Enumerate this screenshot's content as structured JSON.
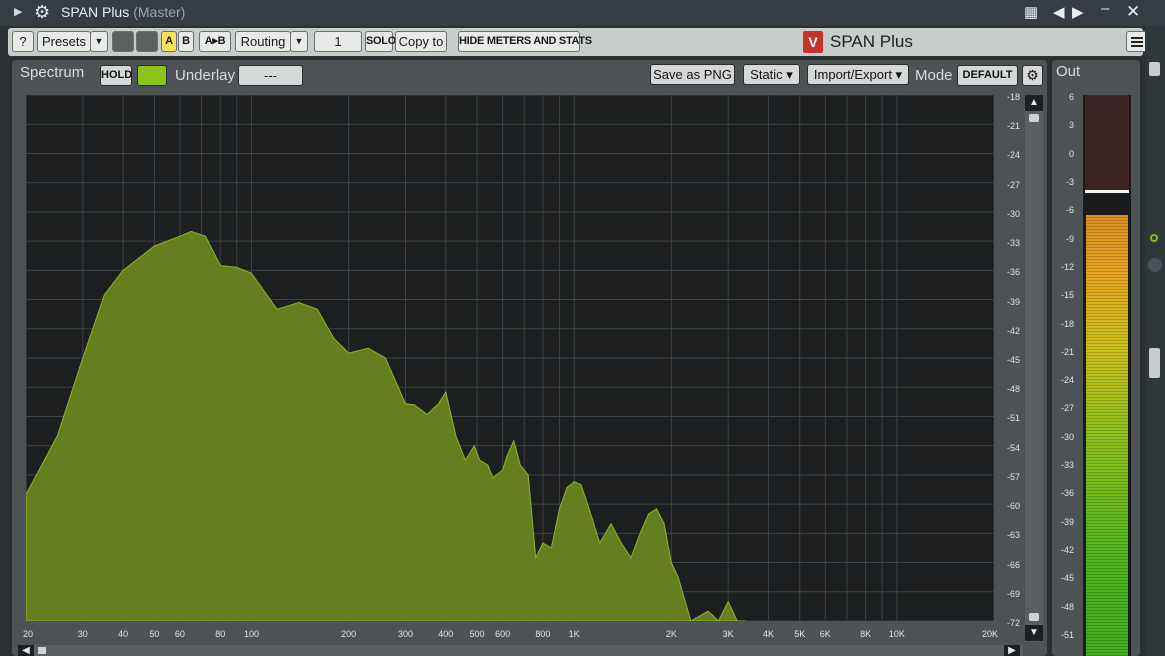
{
  "window": {
    "title": "SPAN Plus",
    "subtitle": "(Master)"
  },
  "toolbar": {
    "help_label": "?",
    "presets_label": "Presets",
    "a_label": "A",
    "b_label": "B",
    "ab_label": "A▸B",
    "routing_label": "Routing",
    "routing_value": "1",
    "solo_label": "SOLO",
    "copy_label": "Copy to",
    "hide_label": "HIDE METERS AND STATS",
    "logo_mark": "V",
    "logo_text": "SPAN Plus"
  },
  "spectrum_bar": {
    "spectrum_label": "Spectrum",
    "hold_label": "HOLD",
    "underlay_label": "Underlay",
    "underlay_value": "---",
    "save_png_label": "Save as PNG",
    "static_label": "Static ▾",
    "import_export_label": "Import/Export ▾",
    "mode_label": "Mode",
    "mode_value": "DEFAULT"
  },
  "out_label": "Out",
  "spectrum": {
    "db_ticks": [
      "-18",
      "-21",
      "-24",
      "-27",
      "-30",
      "-33",
      "-36",
      "-39",
      "-42",
      "-45",
      "-48",
      "-51",
      "-54",
      "-57",
      "-60",
      "-63",
      "-66",
      "-69",
      "-72"
    ],
    "freq_ticks": [
      {
        "label": "20",
        "hz": 20
      },
      {
        "label": "30",
        "hz": 30
      },
      {
        "label": "40",
        "hz": 40
      },
      {
        "label": "50",
        "hz": 50
      },
      {
        "label": "60",
        "hz": 60
      },
      {
        "label": "80",
        "hz": 80
      },
      {
        "label": "100",
        "hz": 100
      },
      {
        "label": "200",
        "hz": 200
      },
      {
        "label": "300",
        "hz": 300
      },
      {
        "label": "400",
        "hz": 400
      },
      {
        "label": "500",
        "hz": 500
      },
      {
        "label": "600",
        "hz": 600
      },
      {
        "label": "800",
        "hz": 800
      },
      {
        "label": "1K",
        "hz": 1000
      },
      {
        "label": "2K",
        "hz": 2000
      },
      {
        "label": "3K",
        "hz": 3000
      },
      {
        "label": "4K",
        "hz": 4000
      },
      {
        "label": "5K",
        "hz": 5000
      },
      {
        "label": "6K",
        "hz": 6000
      },
      {
        "label": "8K",
        "hz": 8000
      },
      {
        "label": "10K",
        "hz": 10000
      },
      {
        "label": "20K",
        "hz": 20000
      }
    ],
    "db_range": [
      -72,
      -18
    ],
    "freq_range_hz": [
      20,
      20000
    ],
    "fill_color": "#6b8720",
    "curve": [
      [
        20,
        -59
      ],
      [
        25,
        -53
      ],
      [
        30,
        -45
      ],
      [
        35,
        -38.5
      ],
      [
        40,
        -36
      ],
      [
        50,
        -33.5
      ],
      [
        60,
        -32.5
      ],
      [
        65,
        -32
      ],
      [
        72,
        -32.5
      ],
      [
        80,
        -35.5
      ],
      [
        90,
        -35.7
      ],
      [
        100,
        -36.3
      ],
      [
        120,
        -40
      ],
      [
        140,
        -39.3
      ],
      [
        160,
        -40
      ],
      [
        180,
        -43
      ],
      [
        200,
        -44.5
      ],
      [
        230,
        -44
      ],
      [
        260,
        -45
      ],
      [
        300,
        -49.7
      ],
      [
        320,
        -49.8
      ],
      [
        350,
        -50.8
      ],
      [
        380,
        -49.7
      ],
      [
        400,
        -48.5
      ],
      [
        430,
        -53
      ],
      [
        460,
        -55.5
      ],
      [
        490,
        -54
      ],
      [
        510,
        -55.5
      ],
      [
        540,
        -56
      ],
      [
        560,
        -57.3
      ],
      [
        600,
        -56.5
      ],
      [
        620,
        -55
      ],
      [
        650,
        -53.5
      ],
      [
        680,
        -56
      ],
      [
        720,
        -57
      ],
      [
        760,
        -65.5
      ],
      [
        800,
        -64
      ],
      [
        850,
        -64.5
      ],
      [
        900,
        -60.5
      ],
      [
        950,
        -58.3
      ],
      [
        1000,
        -57.7
      ],
      [
        1050,
        -58
      ],
      [
        1100,
        -60
      ],
      [
        1200,
        -64
      ],
      [
        1300,
        -62
      ],
      [
        1400,
        -64
      ],
      [
        1500,
        -65.5
      ],
      [
        1600,
        -63
      ],
      [
        1700,
        -61
      ],
      [
        1800,
        -60.5
      ],
      [
        1900,
        -62
      ],
      [
        2000,
        -66
      ],
      [
        2100,
        -67.5
      ],
      [
        2300,
        -72
      ],
      [
        2600,
        -71
      ],
      [
        2800,
        -72
      ],
      [
        3000,
        -70
      ],
      [
        3200,
        -72
      ],
      [
        3400,
        -72
      ]
    ]
  },
  "out_meter": {
    "ticks": [
      "6",
      "3",
      "0",
      "-3",
      "-6",
      "-9",
      "-12",
      "-15",
      "-18",
      "-21",
      "-24",
      "-27",
      "-30",
      "-33",
      "-36",
      "-39",
      "-42",
      "-45",
      "-48",
      "-51"
    ],
    "db_range": [
      -51,
      6
    ],
    "level_db": -6.4,
    "peak_db": -3.8
  },
  "colors": {
    "spectrum_fill": "#6b8720",
    "hold_green": "#8ec31d",
    "ab_yellow": "#f7e25a",
    "logo_red": "#c8322e"
  }
}
